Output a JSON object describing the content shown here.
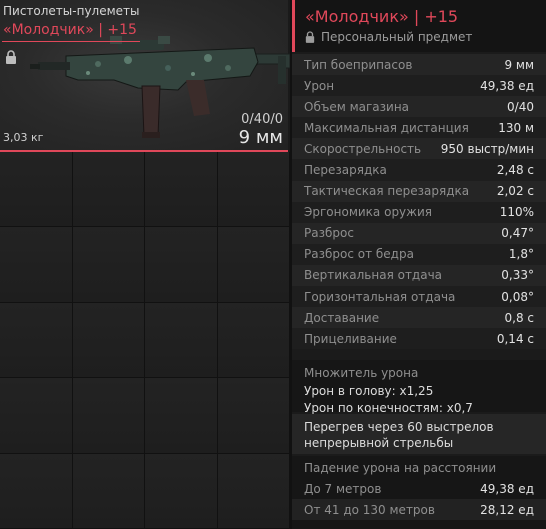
{
  "item_card": {
    "category": "Пистолеты-пулеметы",
    "name": "«Молодчик» | +15",
    "weight": "3,03 кг",
    "ammo_count": "0/40/0",
    "ammo_caliber": "9 мм"
  },
  "details": {
    "name": "«Молодчик» | +15",
    "personal": "Персональный предмет",
    "stats": [
      {
        "label": "Тип боеприпасов",
        "value": "9 мм"
      },
      {
        "label": "Урон",
        "value": "49,38 ед"
      },
      {
        "label": "Объем магазина",
        "value": "0/40"
      },
      {
        "label": "Максимальная дистанция",
        "value": "130 м"
      },
      {
        "label": "Скорострельность",
        "value": "950 выстр/мин"
      },
      {
        "label": "Перезарядка",
        "value": "2,48 с"
      },
      {
        "label": "Тактическая перезарядка",
        "value": "2,02 с"
      },
      {
        "label": "Эргономика оружия",
        "value": "110%"
      },
      {
        "label": "Разброс",
        "value": "0,47°"
      },
      {
        "label": "Разброс от бедра",
        "value": "1,8°"
      },
      {
        "label": "Вертикальная отдача",
        "value": "0,33°"
      },
      {
        "label": "Горизонтальная отдача",
        "value": "0,08°"
      },
      {
        "label": "Доставание",
        "value": "0,8 с"
      },
      {
        "label": "Прицеливание",
        "value": "0,14 с"
      }
    ],
    "multiplier": {
      "title": "Множитель урона",
      "head": "Урон в голову: x1,25",
      "limbs": "Урон по конечностям: x0,7"
    },
    "overheat": {
      "line1": "Перегрев через 60 выстрелов",
      "line2": "непрерывной стрельбы"
    },
    "falloff": {
      "title": "Падение урона на расстоянии",
      "rows": [
        {
          "label": "До 7 метров",
          "value": "49,38 ед"
        },
        {
          "label": "От 41 до 130 метров",
          "value": "28,12 ед"
        }
      ]
    }
  },
  "colors": {
    "accent": "#e0485a",
    "background": "#1d1d1d"
  },
  "icons": [
    "lock-icon",
    "weapon-image"
  ]
}
